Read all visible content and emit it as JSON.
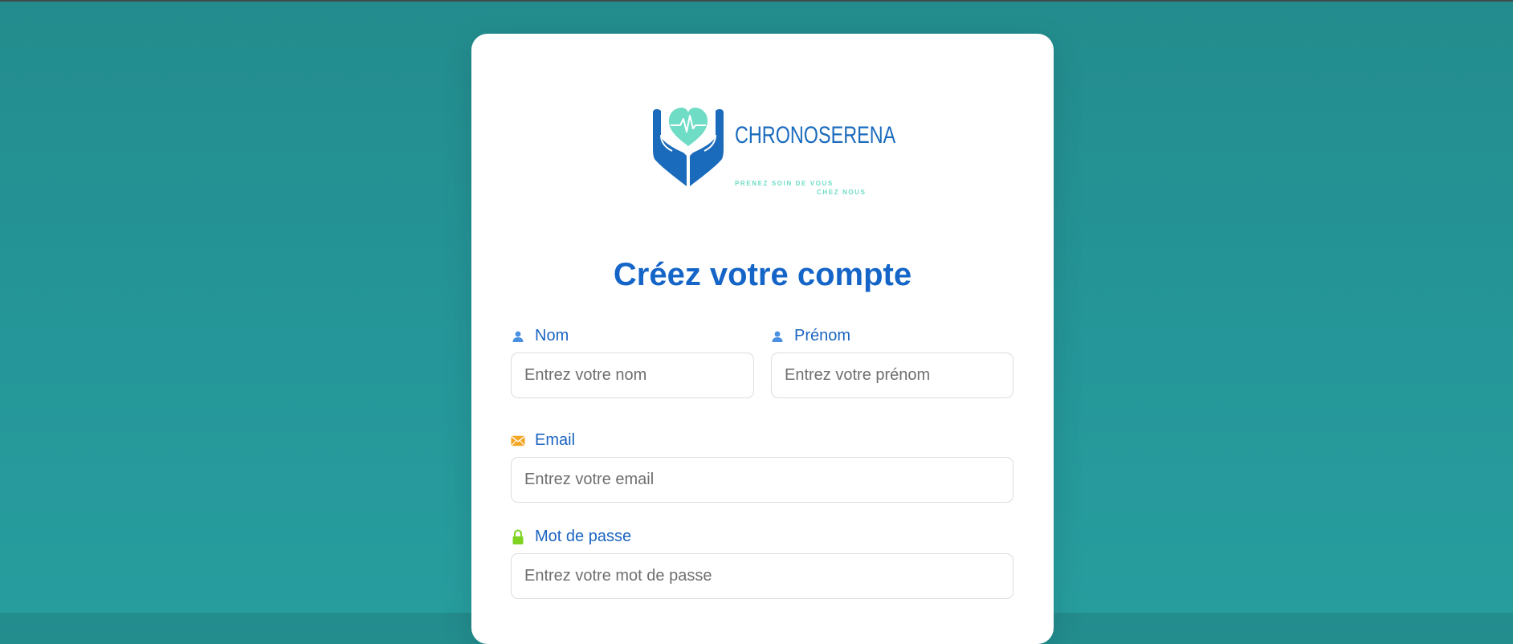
{
  "brand": {
    "name": "CHRONOSERENA",
    "tagline_line1": "PRENEZ SOIN DE VOUS",
    "tagline_line2": "CHEZ NOUS"
  },
  "form": {
    "title": "Créez votre compte",
    "fields": {
      "nom": {
        "label": "Nom",
        "placeholder": "Entrez votre nom",
        "icon": "user-icon"
      },
      "prenom": {
        "label": "Prénom",
        "placeholder": "Entrez votre prénom",
        "icon": "user-icon"
      },
      "email": {
        "label": "Email",
        "placeholder": "Entrez votre email",
        "icon": "envelope-icon"
      },
      "password": {
        "label": "Mot de passe",
        "placeholder": "Entrez votre mot de passe",
        "icon": "lock-icon"
      }
    }
  },
  "colors": {
    "background": "#25979a",
    "primary": "#1565c8",
    "brand_blue": "#1b6bbd",
    "brand_mint": "#6fdcc5",
    "email_icon": "#f4a623",
    "lock_icon": "#7ed321"
  }
}
